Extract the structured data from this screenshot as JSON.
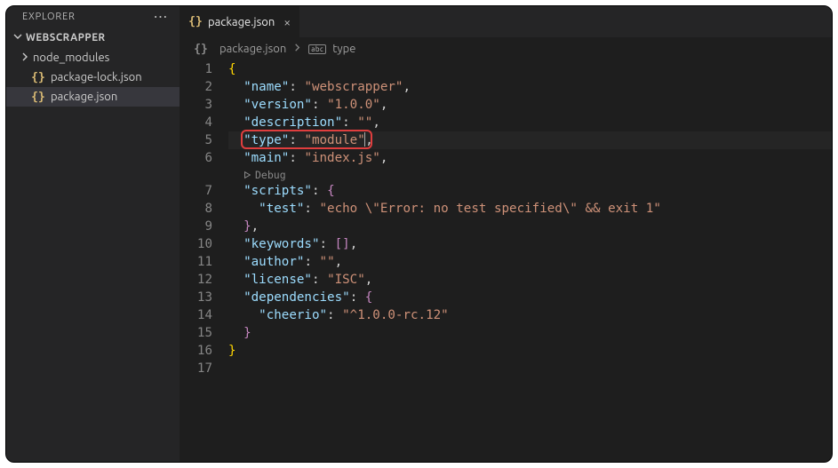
{
  "sidebar": {
    "title": "EXPLORER",
    "project": "WEBSCRAPPER",
    "items": [
      {
        "label": "node_modules",
        "type": "folder"
      },
      {
        "label": "package-lock.json",
        "type": "json"
      },
      {
        "label": "package.json",
        "type": "json",
        "selected": true
      }
    ]
  },
  "tab": {
    "filename": "package.json"
  },
  "breadcrumb": {
    "file": "package.json",
    "symbol": "type"
  },
  "codelens": {
    "label": "Debug"
  },
  "code": {
    "highlighted_line": 5,
    "lines": [
      [
        {
          "c": "brace",
          "t": "{"
        }
      ],
      [
        {
          "c": "ind",
          "t": "  "
        },
        {
          "c": "key",
          "t": "\"name\""
        },
        {
          "c": "punc",
          "t": ": "
        },
        {
          "c": "str",
          "t": "\"webscrapper\""
        },
        {
          "c": "punc",
          "t": ","
        }
      ],
      [
        {
          "c": "ind",
          "t": "  "
        },
        {
          "c": "key",
          "t": "\"version\""
        },
        {
          "c": "punc",
          "t": ": "
        },
        {
          "c": "str",
          "t": "\"1.0.0\""
        },
        {
          "c": "punc",
          "t": ","
        }
      ],
      [
        {
          "c": "ind",
          "t": "  "
        },
        {
          "c": "key",
          "t": "\"description\""
        },
        {
          "c": "punc",
          "t": ": "
        },
        {
          "c": "str",
          "t": "\"\""
        },
        {
          "c": "punc",
          "t": ","
        }
      ],
      [
        {
          "c": "ind",
          "t": "  "
        },
        {
          "c": "key",
          "t": "\"type\""
        },
        {
          "c": "punc",
          "t": ": "
        },
        {
          "c": "str",
          "t": "\"module\""
        },
        {
          "c": "cursor",
          "t": ""
        },
        {
          "c": "punc",
          "t": ","
        }
      ],
      [
        {
          "c": "ind",
          "t": "  "
        },
        {
          "c": "key",
          "t": "\"main\""
        },
        {
          "c": "punc",
          "t": ": "
        },
        {
          "c": "str",
          "t": "\"index.js\""
        },
        {
          "c": "punc",
          "t": ","
        }
      ],
      [
        {
          "c": "ind",
          "t": "  "
        },
        {
          "c": "key",
          "t": "\"scripts\""
        },
        {
          "c": "punc",
          "t": ": "
        },
        {
          "c": "brace-pink",
          "t": "{"
        }
      ],
      [
        {
          "c": "ind",
          "t": "    "
        },
        {
          "c": "key",
          "t": "\"test\""
        },
        {
          "c": "punc",
          "t": ": "
        },
        {
          "c": "str",
          "t": "\"echo \\\"Error: no test specified\\\" && exit 1\""
        }
      ],
      [
        {
          "c": "ind",
          "t": "  "
        },
        {
          "c": "brace-pink",
          "t": "}"
        },
        {
          "c": "punc",
          "t": ","
        }
      ],
      [
        {
          "c": "ind",
          "t": "  "
        },
        {
          "c": "key",
          "t": "\"keywords\""
        },
        {
          "c": "punc",
          "t": ": "
        },
        {
          "c": "brace-pink",
          "t": "[]"
        },
        {
          "c": "punc",
          "t": ","
        }
      ],
      [
        {
          "c": "ind",
          "t": "  "
        },
        {
          "c": "key",
          "t": "\"author\""
        },
        {
          "c": "punc",
          "t": ": "
        },
        {
          "c": "str",
          "t": "\"\""
        },
        {
          "c": "punc",
          "t": ","
        }
      ],
      [
        {
          "c": "ind",
          "t": "  "
        },
        {
          "c": "key",
          "t": "\"license\""
        },
        {
          "c": "punc",
          "t": ": "
        },
        {
          "c": "str",
          "t": "\"ISC\""
        },
        {
          "c": "punc",
          "t": ","
        }
      ],
      [
        {
          "c": "ind",
          "t": "  "
        },
        {
          "c": "key",
          "t": "\"dependencies\""
        },
        {
          "c": "punc",
          "t": ": "
        },
        {
          "c": "brace-pink",
          "t": "{"
        }
      ],
      [
        {
          "c": "ind",
          "t": "    "
        },
        {
          "c": "key",
          "t": "\"cheerio\""
        },
        {
          "c": "punc",
          "t": ": "
        },
        {
          "c": "str",
          "t": "\"^1.0.0-rc.12\""
        }
      ],
      [
        {
          "c": "ind",
          "t": "  "
        },
        {
          "c": "brace-pink",
          "t": "}"
        }
      ],
      [
        {
          "c": "brace",
          "t": "}"
        }
      ],
      []
    ]
  }
}
